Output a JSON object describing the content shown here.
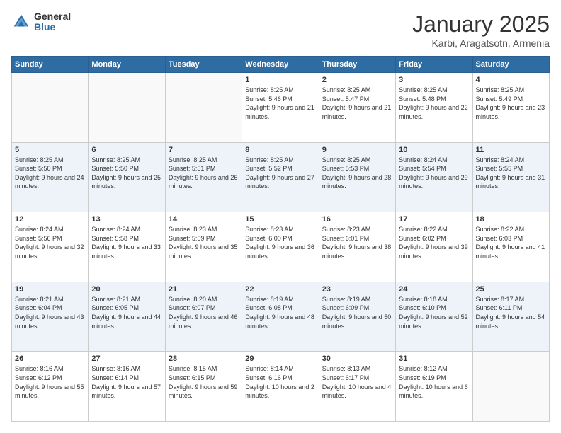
{
  "header": {
    "logo_general": "General",
    "logo_blue": "Blue",
    "month_title": "January 2025",
    "location": "Karbi, Aragatsotn, Armenia"
  },
  "weekdays": [
    "Sunday",
    "Monday",
    "Tuesday",
    "Wednesday",
    "Thursday",
    "Friday",
    "Saturday"
  ],
  "weeks": [
    [
      {
        "day": "",
        "sunrise": "",
        "sunset": "",
        "daylight": ""
      },
      {
        "day": "",
        "sunrise": "",
        "sunset": "",
        "daylight": ""
      },
      {
        "day": "",
        "sunrise": "",
        "sunset": "",
        "daylight": ""
      },
      {
        "day": "1",
        "sunrise": "Sunrise: 8:25 AM",
        "sunset": "Sunset: 5:46 PM",
        "daylight": "Daylight: 9 hours and 21 minutes."
      },
      {
        "day": "2",
        "sunrise": "Sunrise: 8:25 AM",
        "sunset": "Sunset: 5:47 PM",
        "daylight": "Daylight: 9 hours and 21 minutes."
      },
      {
        "day": "3",
        "sunrise": "Sunrise: 8:25 AM",
        "sunset": "Sunset: 5:48 PM",
        "daylight": "Daylight: 9 hours and 22 minutes."
      },
      {
        "day": "4",
        "sunrise": "Sunrise: 8:25 AM",
        "sunset": "Sunset: 5:49 PM",
        "daylight": "Daylight: 9 hours and 23 minutes."
      }
    ],
    [
      {
        "day": "5",
        "sunrise": "Sunrise: 8:25 AM",
        "sunset": "Sunset: 5:50 PM",
        "daylight": "Daylight: 9 hours and 24 minutes."
      },
      {
        "day": "6",
        "sunrise": "Sunrise: 8:25 AM",
        "sunset": "Sunset: 5:50 PM",
        "daylight": "Daylight: 9 hours and 25 minutes."
      },
      {
        "day": "7",
        "sunrise": "Sunrise: 8:25 AM",
        "sunset": "Sunset: 5:51 PM",
        "daylight": "Daylight: 9 hours and 26 minutes."
      },
      {
        "day": "8",
        "sunrise": "Sunrise: 8:25 AM",
        "sunset": "Sunset: 5:52 PM",
        "daylight": "Daylight: 9 hours and 27 minutes."
      },
      {
        "day": "9",
        "sunrise": "Sunrise: 8:25 AM",
        "sunset": "Sunset: 5:53 PM",
        "daylight": "Daylight: 9 hours and 28 minutes."
      },
      {
        "day": "10",
        "sunrise": "Sunrise: 8:24 AM",
        "sunset": "Sunset: 5:54 PM",
        "daylight": "Daylight: 9 hours and 29 minutes."
      },
      {
        "day": "11",
        "sunrise": "Sunrise: 8:24 AM",
        "sunset": "Sunset: 5:55 PM",
        "daylight": "Daylight: 9 hours and 31 minutes."
      }
    ],
    [
      {
        "day": "12",
        "sunrise": "Sunrise: 8:24 AM",
        "sunset": "Sunset: 5:56 PM",
        "daylight": "Daylight: 9 hours and 32 minutes."
      },
      {
        "day": "13",
        "sunrise": "Sunrise: 8:24 AM",
        "sunset": "Sunset: 5:58 PM",
        "daylight": "Daylight: 9 hours and 33 minutes."
      },
      {
        "day": "14",
        "sunrise": "Sunrise: 8:23 AM",
        "sunset": "Sunset: 5:59 PM",
        "daylight": "Daylight: 9 hours and 35 minutes."
      },
      {
        "day": "15",
        "sunrise": "Sunrise: 8:23 AM",
        "sunset": "Sunset: 6:00 PM",
        "daylight": "Daylight: 9 hours and 36 minutes."
      },
      {
        "day": "16",
        "sunrise": "Sunrise: 8:23 AM",
        "sunset": "Sunset: 6:01 PM",
        "daylight": "Daylight: 9 hours and 38 minutes."
      },
      {
        "day": "17",
        "sunrise": "Sunrise: 8:22 AM",
        "sunset": "Sunset: 6:02 PM",
        "daylight": "Daylight: 9 hours and 39 minutes."
      },
      {
        "day": "18",
        "sunrise": "Sunrise: 8:22 AM",
        "sunset": "Sunset: 6:03 PM",
        "daylight": "Daylight: 9 hours and 41 minutes."
      }
    ],
    [
      {
        "day": "19",
        "sunrise": "Sunrise: 8:21 AM",
        "sunset": "Sunset: 6:04 PM",
        "daylight": "Daylight: 9 hours and 43 minutes."
      },
      {
        "day": "20",
        "sunrise": "Sunrise: 8:21 AM",
        "sunset": "Sunset: 6:05 PM",
        "daylight": "Daylight: 9 hours and 44 minutes."
      },
      {
        "day": "21",
        "sunrise": "Sunrise: 8:20 AM",
        "sunset": "Sunset: 6:07 PM",
        "daylight": "Daylight: 9 hours and 46 minutes."
      },
      {
        "day": "22",
        "sunrise": "Sunrise: 8:19 AM",
        "sunset": "Sunset: 6:08 PM",
        "daylight": "Daylight: 9 hours and 48 minutes."
      },
      {
        "day": "23",
        "sunrise": "Sunrise: 8:19 AM",
        "sunset": "Sunset: 6:09 PM",
        "daylight": "Daylight: 9 hours and 50 minutes."
      },
      {
        "day": "24",
        "sunrise": "Sunrise: 8:18 AM",
        "sunset": "Sunset: 6:10 PM",
        "daylight": "Daylight: 9 hours and 52 minutes."
      },
      {
        "day": "25",
        "sunrise": "Sunrise: 8:17 AM",
        "sunset": "Sunset: 6:11 PM",
        "daylight": "Daylight: 9 hours and 54 minutes."
      }
    ],
    [
      {
        "day": "26",
        "sunrise": "Sunrise: 8:16 AM",
        "sunset": "Sunset: 6:12 PM",
        "daylight": "Daylight: 9 hours and 55 minutes."
      },
      {
        "day": "27",
        "sunrise": "Sunrise: 8:16 AM",
        "sunset": "Sunset: 6:14 PM",
        "daylight": "Daylight: 9 hours and 57 minutes."
      },
      {
        "day": "28",
        "sunrise": "Sunrise: 8:15 AM",
        "sunset": "Sunset: 6:15 PM",
        "daylight": "Daylight: 9 hours and 59 minutes."
      },
      {
        "day": "29",
        "sunrise": "Sunrise: 8:14 AM",
        "sunset": "Sunset: 6:16 PM",
        "daylight": "Daylight: 10 hours and 2 minutes."
      },
      {
        "day": "30",
        "sunrise": "Sunrise: 8:13 AM",
        "sunset": "Sunset: 6:17 PM",
        "daylight": "Daylight: 10 hours and 4 minutes."
      },
      {
        "day": "31",
        "sunrise": "Sunrise: 8:12 AM",
        "sunset": "Sunset: 6:19 PM",
        "daylight": "Daylight: 10 hours and 6 minutes."
      },
      {
        "day": "",
        "sunrise": "",
        "sunset": "",
        "daylight": ""
      }
    ]
  ]
}
